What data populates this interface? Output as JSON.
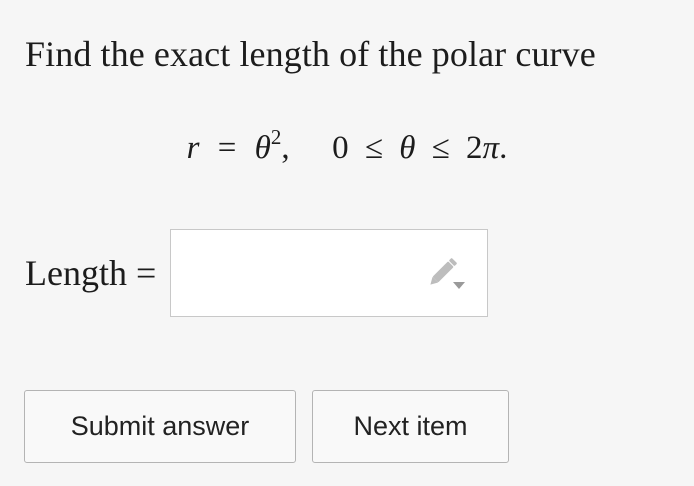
{
  "question": {
    "prompt": "Find the exact length of the polar curve",
    "equation": {
      "lhs": "r",
      "eq": "=",
      "base": "θ",
      "exponent": "2",
      "comma": ",",
      "range_low": "0",
      "le1": "≤",
      "var": "θ",
      "le2": "≤",
      "range_high_coef": "2",
      "range_high_sym": "π",
      "period": "."
    }
  },
  "answer": {
    "label": "Length =",
    "value": "",
    "placeholder": "",
    "icon": "pencil-dropdown-icon"
  },
  "buttons": {
    "submit_label": "Submit answer",
    "next_label": "Next item"
  },
  "colors": {
    "background": "#f6f6f6",
    "field_border": "#c8c8c8",
    "button_border": "#b4b4b4",
    "icon_gray": "#bdbdbd"
  }
}
